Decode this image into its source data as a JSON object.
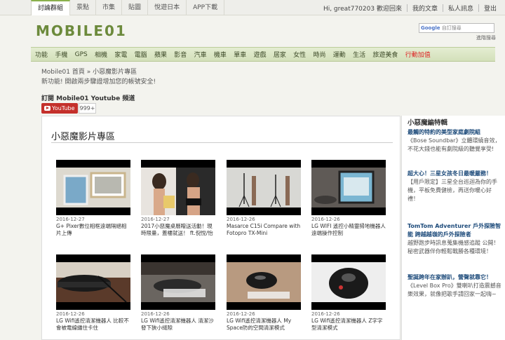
{
  "top_tabs": [
    "討論群組",
    "景點",
    "市集",
    "貼圖",
    "悅遊日本",
    "APP下載"
  ],
  "user_links": [
    "Hi, great770203 歡迎回來",
    "我的文章",
    "私人訊息",
    "登出"
  ],
  "logo_text": "MOBILE01",
  "search": {
    "brand": "Google",
    "placeholder": "自訂搜尋",
    "advanced": "進階搜尋"
  },
  "nav": [
    "功能",
    "手機",
    "GPS",
    "相機",
    "家電",
    "電腦",
    "蘋果",
    "影音",
    "汽車",
    "機車",
    "單車",
    "遊戲",
    "居家",
    "女性",
    "時尚",
    "運動",
    "生活",
    "旅遊美食",
    "行動加值"
  ],
  "breadcrumb": "Mobile01 首頁 » 小惡魔影片專區",
  "notice": "新功能! 開啟兩步驟證增加您的帳號安全!",
  "youtube": {
    "title": "訂閱 Mobile01 Youtube 頻道",
    "button": "YouTube",
    "count": "999+"
  },
  "main": {
    "title": "小惡魔影片專區",
    "videos": [
      {
        "date": "2016-12-27",
        "title": "G+ Pixer數位相框遠端隔絕相片上傳"
      },
      {
        "date": "2016-12-27",
        "title": "2017小惡魔桌曆贈送活動！現時限量，蓋樓就送！ ft.倪悅/怡哥"
      },
      {
        "date": "2016-12-26",
        "title": "Masarce C15i Compare with Fotopro TX-Mini"
      },
      {
        "date": "2016-12-26",
        "title": "LG WIFI 遙控小精靈掃地機器人 遠端操作控制"
      },
      {
        "date": "2016-12-26",
        "title": "LG Wifi遙控清潔機器人 比較不會被電線纏住卡住"
      },
      {
        "date": "2016-12-26",
        "title": "LG Wifi遙控清潔機器人 清潔沙發下狹小縫隙"
      },
      {
        "date": "2016-12-26",
        "title": "LG Wifi遙控清潔機器人 My Space防的空間清潔模式"
      },
      {
        "date": "2016-12-26",
        "title": "LG Wifi遙控清潔機器人 Z字字型清潔模式"
      }
    ]
  },
  "sidebar": {
    "heading": "小惡魔編特輯",
    "items": [
      {
        "title": "最觸的特約的美型家庭劇院組",
        "desc": "《Bose Soundbar》立體環繞音效，不花大錢也能有劇院級的聽覺享受!"
      },
      {
        "title": "超大心！三星女孩冬日最暖嚴務！",
        "desc": "【用戶限定】三星全台巡迴為你的手機，平板免費健檢，再送你暖心好禮！"
      },
      {
        "title": "TomTom Adventurer 戶外探險智能 跨越越嶺的戶外探險者",
        "desc": "越野跑步時訊息蒐集機感追蹤 公開！秘密武器伴你輕鬆戰勝各種環境！"
      },
      {
        "title": "聖誕跨年在家辦趴，營聲就靠它！",
        "desc": "《Level Box Pro》雙喇叭打造震撼音樂效果，就像把歌手請回家一起嗨~"
      }
    ]
  }
}
